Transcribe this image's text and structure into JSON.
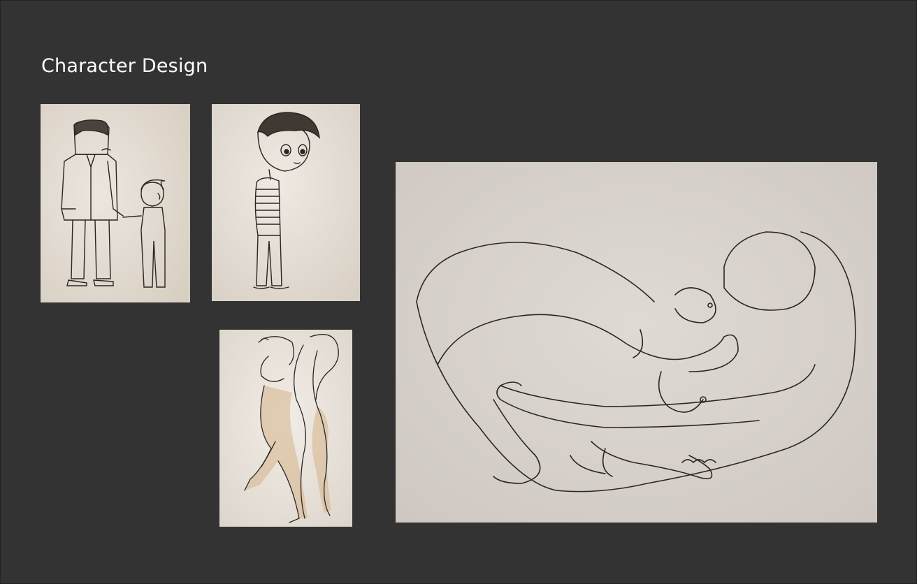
{
  "page": {
    "title": "Character Design",
    "background_color": "#333333"
  },
  "sketches": [
    {
      "name": "father-and-son-sketch",
      "paper": "#e4ddd4"
    },
    {
      "name": "boy-striped-shirt-sketch",
      "paper": "#e6ded6"
    },
    {
      "name": "twisting-figure-sketch",
      "paper": "#e9e3dc"
    },
    {
      "name": "curled-figure-sketch",
      "paper": "#d9d3ce"
    }
  ]
}
